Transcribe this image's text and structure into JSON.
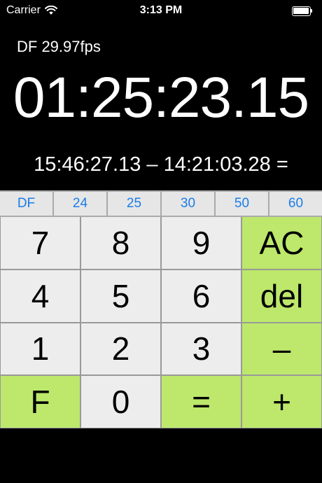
{
  "status_bar": {
    "carrier": "Carrier",
    "time": "3:13 PM"
  },
  "display": {
    "mode": "DF 29.97fps",
    "result": "01:25:23.15",
    "expression": "15:46:27.13 – 14:21:03.28 ="
  },
  "fps_buttons": [
    "DF",
    "24",
    "25",
    "30",
    "50",
    "60"
  ],
  "keys": {
    "k7": "7",
    "k8": "8",
    "k9": "9",
    "ac": "AC",
    "k4": "4",
    "k5": "5",
    "k6": "6",
    "del": "del",
    "k1": "1",
    "k2": "2",
    "k3": "3",
    "minus": "–",
    "f": "F",
    "k0": "0",
    "equals": "=",
    "plus": "+"
  },
  "colors": {
    "accent_green": "#bde86b",
    "fps_blue": "#1a7de8",
    "key_gray": "#ededed"
  }
}
